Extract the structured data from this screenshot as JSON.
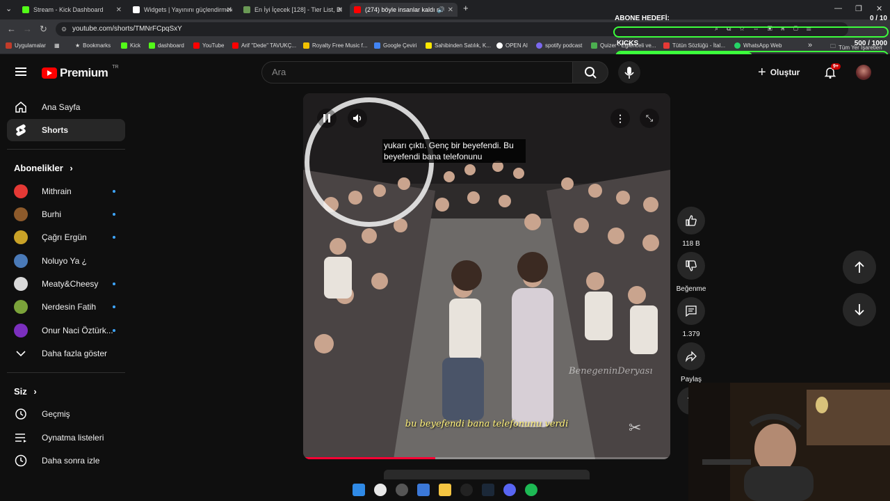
{
  "browser": {
    "tabs": [
      {
        "label": "Stream - Kick Dashboard",
        "color": "#53fc18"
      },
      {
        "label": "Widgets | Yayınını güçlendirmek",
        "color": "#ffffff"
      },
      {
        "label": "En İyi İçecek [128] - Tier List, Bl",
        "color": "#6a9955"
      },
      {
        "label": "(274) böyle insanlar kaldı m",
        "color": "#ff0000"
      }
    ],
    "new_tab": "+",
    "url": "youtube.com/shorts/TMNrFCpqSxY",
    "bookmarks": [
      {
        "label": "Uygulamalar",
        "color": "#c23c2a"
      },
      {
        "label": "Bookmarks",
        "color": "#e0e0e0"
      },
      {
        "label": "Kick",
        "color": "#53fc18"
      },
      {
        "label": "dashboard",
        "color": "#53fc18"
      },
      {
        "label": "YouTube",
        "color": "#ff0000"
      },
      {
        "label": "Arif \"Dede\" TAVUKÇ...",
        "color": "#ff0000"
      },
      {
        "label": "Royalty Free Music f...",
        "color": "#f2c200"
      },
      {
        "label": "Google Çeviri",
        "color": "#4285f4"
      },
      {
        "label": "Sahibinden Satılık, K...",
        "color": "#ffe800"
      },
      {
        "label": "OPEN AI",
        "color": "#ffffff"
      },
      {
        "label": "spotify podcast",
        "color": "#7b68ee"
      },
      {
        "label": "Quizer - Eğlenceli ve...",
        "color": "#4caf50"
      },
      {
        "label": "Tütün Sözlüğü - İtal...",
        "color": "#e53935"
      },
      {
        "label": "WhatsApp Web",
        "color": "#25d366"
      },
      {
        "label": "»",
        "color": ""
      },
      {
        "label": "Tüm Yer İşaretleri",
        "color": "#bdbdbd"
      }
    ]
  },
  "overlay": {
    "abone_title": "ABONE HEDEFİ:",
    "abone_count": "0 / 10",
    "abone_progress": 0,
    "kicks_title": "KICKS",
    "kicks_count": "500 / 1000",
    "kicks_progress": 0.5,
    "accent": "#3cff3c"
  },
  "header": {
    "logo_text": "Premium",
    "country": "TR",
    "search_placeholder": "Ara",
    "create_label": "Oluştur",
    "notif_badge": "9+"
  },
  "sidebar": {
    "items": [
      {
        "label": "Ana Sayfa",
        "icon": "home-icon"
      },
      {
        "label": "Shorts",
        "icon": "shorts-icon"
      }
    ],
    "subs_heading": "Abonelikler",
    "subscriptions": [
      {
        "label": "Mithrain",
        "color": "#e53935",
        "live": true
      },
      {
        "label": "Burhi",
        "color": "#8d5a2b",
        "live": true
      },
      {
        "label": "Çağrı Ergün",
        "color": "#c9a227",
        "live": true
      },
      {
        "label": "Noluyo Ya ¿",
        "color": "#4a7ab8",
        "live": false
      },
      {
        "label": "Meaty&Cheesy",
        "color": "#d9d9d9",
        "live": true
      },
      {
        "label": "Nerdesin Fatih",
        "color": "#7ba33a",
        "live": true
      },
      {
        "label": "Onur Naci Öztürk...",
        "color": "#7b2fbe",
        "live": true
      }
    ],
    "show_more": "Daha fazla göster",
    "you_heading": "Siz",
    "you_items": [
      {
        "label": "Geçmiş",
        "icon": "history-icon"
      },
      {
        "label": "Oynatma listeleri",
        "icon": "playlist-icon"
      },
      {
        "label": "Daha sonra izle",
        "icon": "watch-later-icon"
      }
    ]
  },
  "video": {
    "caption_top": "yukarı çıktı. Genç bir beyefendi. Bu beyefendi bana telefonunu",
    "caption_bottom": "bu beyefendi bana telefonunu verdi",
    "watermark": "BenegeninDeryası",
    "progress": 0.36
  },
  "actions": {
    "likes": "118 B",
    "dislike_label": "Beğenme",
    "comments": "1.379",
    "share_label": "Paylaş"
  }
}
